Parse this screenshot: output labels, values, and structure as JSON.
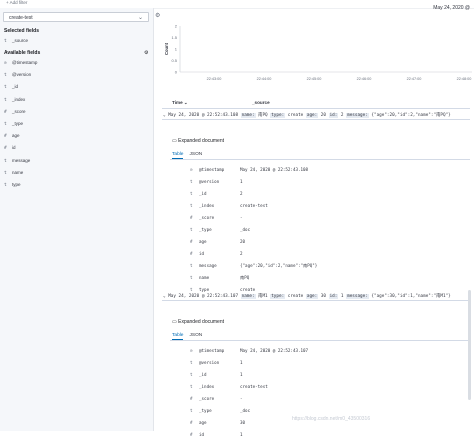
{
  "topbar": {
    "add_label": "+ Add filter"
  },
  "sidebar": {
    "index": "create-test",
    "selected_title": "Selected fields",
    "selected": [
      {
        "type": "t",
        "name": "_source"
      }
    ],
    "available_title": "Available fields",
    "available": [
      {
        "type": "⊙",
        "name": "@timestamp"
      },
      {
        "type": "t",
        "name": "@version"
      },
      {
        "type": "t",
        "name": "_id"
      },
      {
        "type": "t",
        "name": "_index"
      },
      {
        "type": "#",
        "name": "_score"
      },
      {
        "type": "t",
        "name": "_type"
      },
      {
        "type": "#",
        "name": "age"
      },
      {
        "type": "#",
        "name": "id"
      },
      {
        "type": "t",
        "name": "message"
      },
      {
        "type": "t",
        "name": "name"
      },
      {
        "type": "t",
        "name": "type"
      }
    ]
  },
  "main": {
    "daterange": "May 24, 2020 @",
    "table": {
      "col_time": "Time",
      "col_source": "_source"
    },
    "rows": [
      {
        "time": "May 24, 2020 @ 22:52:43.108",
        "summary": [
          {
            "k": "name:",
            "v": "南PQ"
          },
          {
            "k": "type:",
            "v": "create"
          },
          {
            "k": "age:",
            "v": "20"
          },
          {
            "k": "id:",
            "v": "2"
          },
          {
            "k": "message:",
            "v": "{\"age\":20,\"id\":2,\"name\":\"南PQ\"}"
          }
        ],
        "expanded_title": "Expanded document",
        "tabs": [
          "Table",
          "JSON"
        ],
        "fields": [
          {
            "t": "⊙",
            "k": "@timestamp",
            "v": "May 24, 2020 @ 22:52:43.108"
          },
          {
            "t": "t",
            "k": "@version",
            "v": "1"
          },
          {
            "t": "t",
            "k": "_id",
            "v": "2"
          },
          {
            "t": "t",
            "k": "_index",
            "v": "create-test"
          },
          {
            "t": "#",
            "k": "_score",
            "v": "-"
          },
          {
            "t": "t",
            "k": "_type",
            "v": "_doc"
          },
          {
            "t": "#",
            "k": "age",
            "v": "20"
          },
          {
            "t": "#",
            "k": "id",
            "v": "2"
          },
          {
            "t": "t",
            "k": "message",
            "v": "{\"age\":20,\"id\":2,\"name\":\"南PQ\"}"
          },
          {
            "t": "t",
            "k": "name",
            "v": "南PQ"
          },
          {
            "t": "t",
            "k": "type",
            "v": "create"
          }
        ]
      },
      {
        "time": "May 24, 2020 @ 22:52:43.107",
        "summary": [
          {
            "k": "name:",
            "v": "南M1"
          },
          {
            "k": "type:",
            "v": "create"
          },
          {
            "k": "age:",
            "v": "30"
          },
          {
            "k": "id:",
            "v": "1"
          },
          {
            "k": "message:",
            "v": "{\"age\":30,\"id\":1,\"name\":\"南M1\"}"
          }
        ],
        "expanded_title": "Expanded document",
        "tabs": [
          "Table",
          "JSON"
        ],
        "fields": [
          {
            "t": "⊙",
            "k": "@timestamp",
            "v": "May 24, 2020 @ 22:52:43.107"
          },
          {
            "t": "t",
            "k": "@version",
            "v": "1"
          },
          {
            "t": "t",
            "k": "_id",
            "v": "1"
          },
          {
            "t": "t",
            "k": "_index",
            "v": "create-test"
          },
          {
            "t": "#",
            "k": "_score",
            "v": "-"
          },
          {
            "t": "t",
            "k": "_type",
            "v": "_doc"
          },
          {
            "t": "#",
            "k": "age",
            "v": "30"
          },
          {
            "t": "#",
            "k": "id",
            "v": "1"
          }
        ]
      }
    ]
  },
  "chart_data": {
    "type": "bar",
    "ylabel": "Count",
    "yticks": [
      "0",
      "0.5",
      "1",
      "1.5",
      "2"
    ],
    "ylim": [
      0,
      2
    ],
    "categories": [
      "22:43:00",
      "22:44:00",
      "22:45:00",
      "22:46:00",
      "22:47:00",
      "22:48:00"
    ],
    "values": [
      0,
      0,
      0,
      0,
      0,
      0
    ]
  },
  "watermark": "https://blog.csdn.net/m0_43500316"
}
